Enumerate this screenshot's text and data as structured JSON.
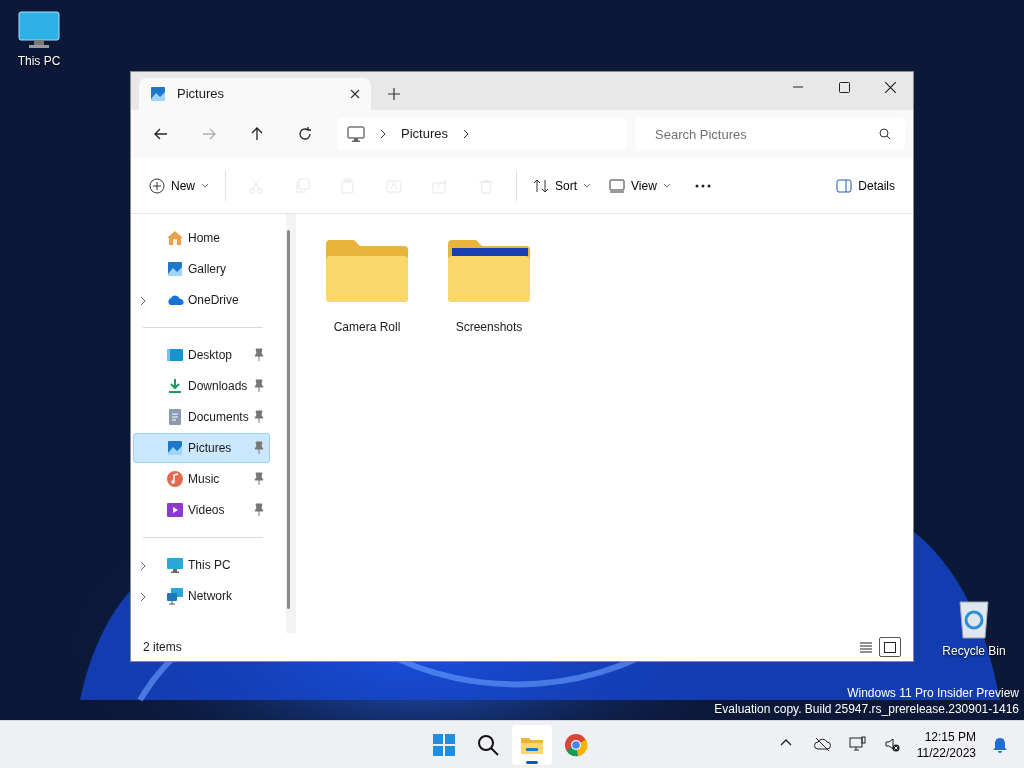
{
  "desktop_icons": [
    {
      "kind": "pc",
      "label": "This PC"
    },
    {
      "kind": "bin",
      "label": "Recycle Bin"
    }
  ],
  "window": {
    "tabs": [
      {
        "label": "Pictures",
        "selected": true
      }
    ],
    "address": {
      "crumbs": [
        "Pictures"
      ]
    },
    "search": {
      "placeholder": "Search Pictures"
    },
    "toolbar": [
      {
        "kind": "new",
        "label": "New",
        "disabled": false
      },
      {
        "kind": "cut",
        "disabled": true
      },
      {
        "kind": "copy",
        "disabled": true
      },
      {
        "kind": "paste",
        "disabled": true
      },
      {
        "kind": "rename",
        "disabled": true
      },
      {
        "kind": "share",
        "disabled": true
      },
      {
        "kind": "delete",
        "disabled": true
      },
      {
        "kind": "sort",
        "label": "Sort",
        "disabled": false
      },
      {
        "kind": "view",
        "label": "View",
        "disabled": false
      },
      {
        "kind": "more",
        "disabled": false
      }
    ],
    "details": "Details",
    "sidebar": [
      [
        {
          "kind": "home",
          "label": "Home",
          "expandable": false,
          "pinned": false,
          "selected": false
        },
        {
          "kind": "gallery",
          "label": "Gallery",
          "expandable": false,
          "pinned": false,
          "selected": false
        },
        {
          "kind": "onedrive",
          "label": "OneDrive",
          "expandable": true,
          "pinned": false,
          "selected": false
        }
      ],
      [
        {
          "kind": "desktop",
          "label": "Desktop",
          "expandable": false,
          "pinned": true,
          "selected": false
        },
        {
          "kind": "downloads",
          "label": "Downloads",
          "expandable": false,
          "pinned": true,
          "selected": false
        },
        {
          "kind": "documents",
          "label": "Documents",
          "expandable": false,
          "pinned": true,
          "selected": false
        },
        {
          "kind": "pictures",
          "label": "Pictures",
          "expandable": false,
          "pinned": true,
          "selected": true
        },
        {
          "kind": "music",
          "label": "Music",
          "expandable": false,
          "pinned": true,
          "selected": false
        },
        {
          "kind": "videos",
          "label": "Videos",
          "expandable": false,
          "pinned": true,
          "selected": false
        }
      ],
      [
        {
          "kind": "pc",
          "label": "This PC",
          "expandable": true,
          "pinned": false,
          "selected": false
        },
        {
          "kind": "network",
          "label": "Network",
          "expandable": true,
          "pinned": false,
          "selected": false
        }
      ]
    ],
    "items": [
      {
        "kind": "folder",
        "label": "Camera Roll"
      },
      {
        "kind": "folder-image",
        "label": "Screenshots"
      }
    ],
    "status_bar": {
      "count": "2 items",
      "views": [
        {
          "kind": "list",
          "selected": false
        },
        {
          "kind": "tiles",
          "selected": true
        }
      ]
    }
  },
  "desktop_notice": [
    "Windows 11 Pro Insider Preview",
    "Evaluation copy. Build 25947.rs_prerelease.230901-1416"
  ],
  "taskbar": {
    "apps": [
      {
        "kind": "start",
        "active": false
      },
      {
        "kind": "search",
        "active": false
      },
      {
        "kind": "explorer",
        "active": true
      },
      {
        "kind": "browser",
        "active": false
      }
    ],
    "time": "12:15 PM",
    "date": "11/22/2023"
  }
}
